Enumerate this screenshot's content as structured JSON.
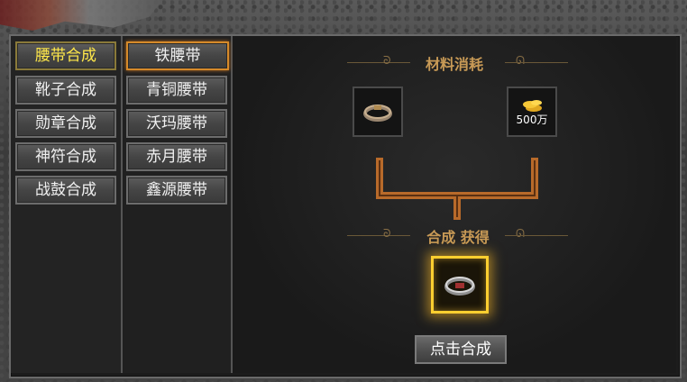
{
  "categories": [
    {
      "label": "腰带合成",
      "selected": true
    },
    {
      "label": "靴子合成",
      "selected": false
    },
    {
      "label": "勋章合成",
      "selected": false
    },
    {
      "label": "神符合成",
      "selected": false
    },
    {
      "label": "战鼓合成",
      "selected": false
    }
  ],
  "items": [
    {
      "label": "铁腰带",
      "selected": true
    },
    {
      "label": "青铜腰带",
      "selected": false
    },
    {
      "label": "沃玛腰带",
      "selected": false
    },
    {
      "label": "赤月腰带",
      "selected": false
    },
    {
      "label": "鑫源腰带",
      "selected": false
    }
  ],
  "materials_title": "材料消耗",
  "materials": [
    {
      "icon": "ring-belt-icon"
    },
    {
      "icon": "gold-coins-icon",
      "amount": "500万"
    }
  ],
  "result_title": "合成 获得",
  "result": {
    "icon": "belt-icon"
  },
  "action_label": "点击合成",
  "colors": {
    "selected_category_text": "#ffe84a",
    "section_title": "#c89a56",
    "connector": "#b86a2a",
    "result_glow": "#ffcf30"
  }
}
